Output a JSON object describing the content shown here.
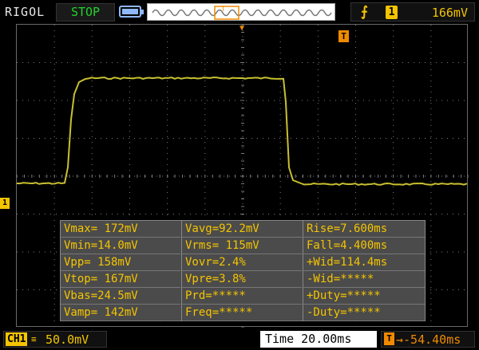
{
  "brand": "RIGOL",
  "status": "STOP",
  "trigger": {
    "source": "1",
    "level": "166mV",
    "marker": "T",
    "position_marker": "▼"
  },
  "channel_marker": "1",
  "colors": {
    "trace": "#c8c030",
    "accent": "#f4c400",
    "trigger": "#f08a00",
    "status": "#22d32a",
    "grid": "#7a7a7a",
    "panel": "#4b4b4b"
  },
  "measurements": {
    "col1": [
      "Vmax= 172mV",
      "Vmin=14.0mV",
      "Vpp= 158mV",
      "Vtop= 167mV",
      "Vbas=24.5mV",
      "Vamp= 142mV"
    ],
    "col2": [
      "Vavg=92.2mV",
      "Vrms= 115mV",
      "Vovr=2.4%",
      "Vpre=3.8%",
      "Prd=*****",
      "Freq=*****"
    ],
    "col3": [
      "Rise=7.600ms",
      "Fall=4.400ms",
      "+Wid=114.4ms",
      "-Wid=*****",
      "+Duty=*****",
      "-Duty=*****"
    ]
  },
  "bottom": {
    "channel_label": "CH1",
    "coupling_symbol": "≡",
    "volts_per_div": "50.0mV",
    "time_label": "Time",
    "time_per_div": "20.00ms",
    "offset_icon": "T",
    "offset_arrow": "→",
    "time_offset": "-54.40ms"
  },
  "icons": [
    "battery-icon",
    "memory-strip-icon",
    "rising-edge-icon",
    "trigger-position-icon",
    "trigger-level-icon",
    "channel1-ground-icon",
    "timebase-offset-icon"
  ]
}
